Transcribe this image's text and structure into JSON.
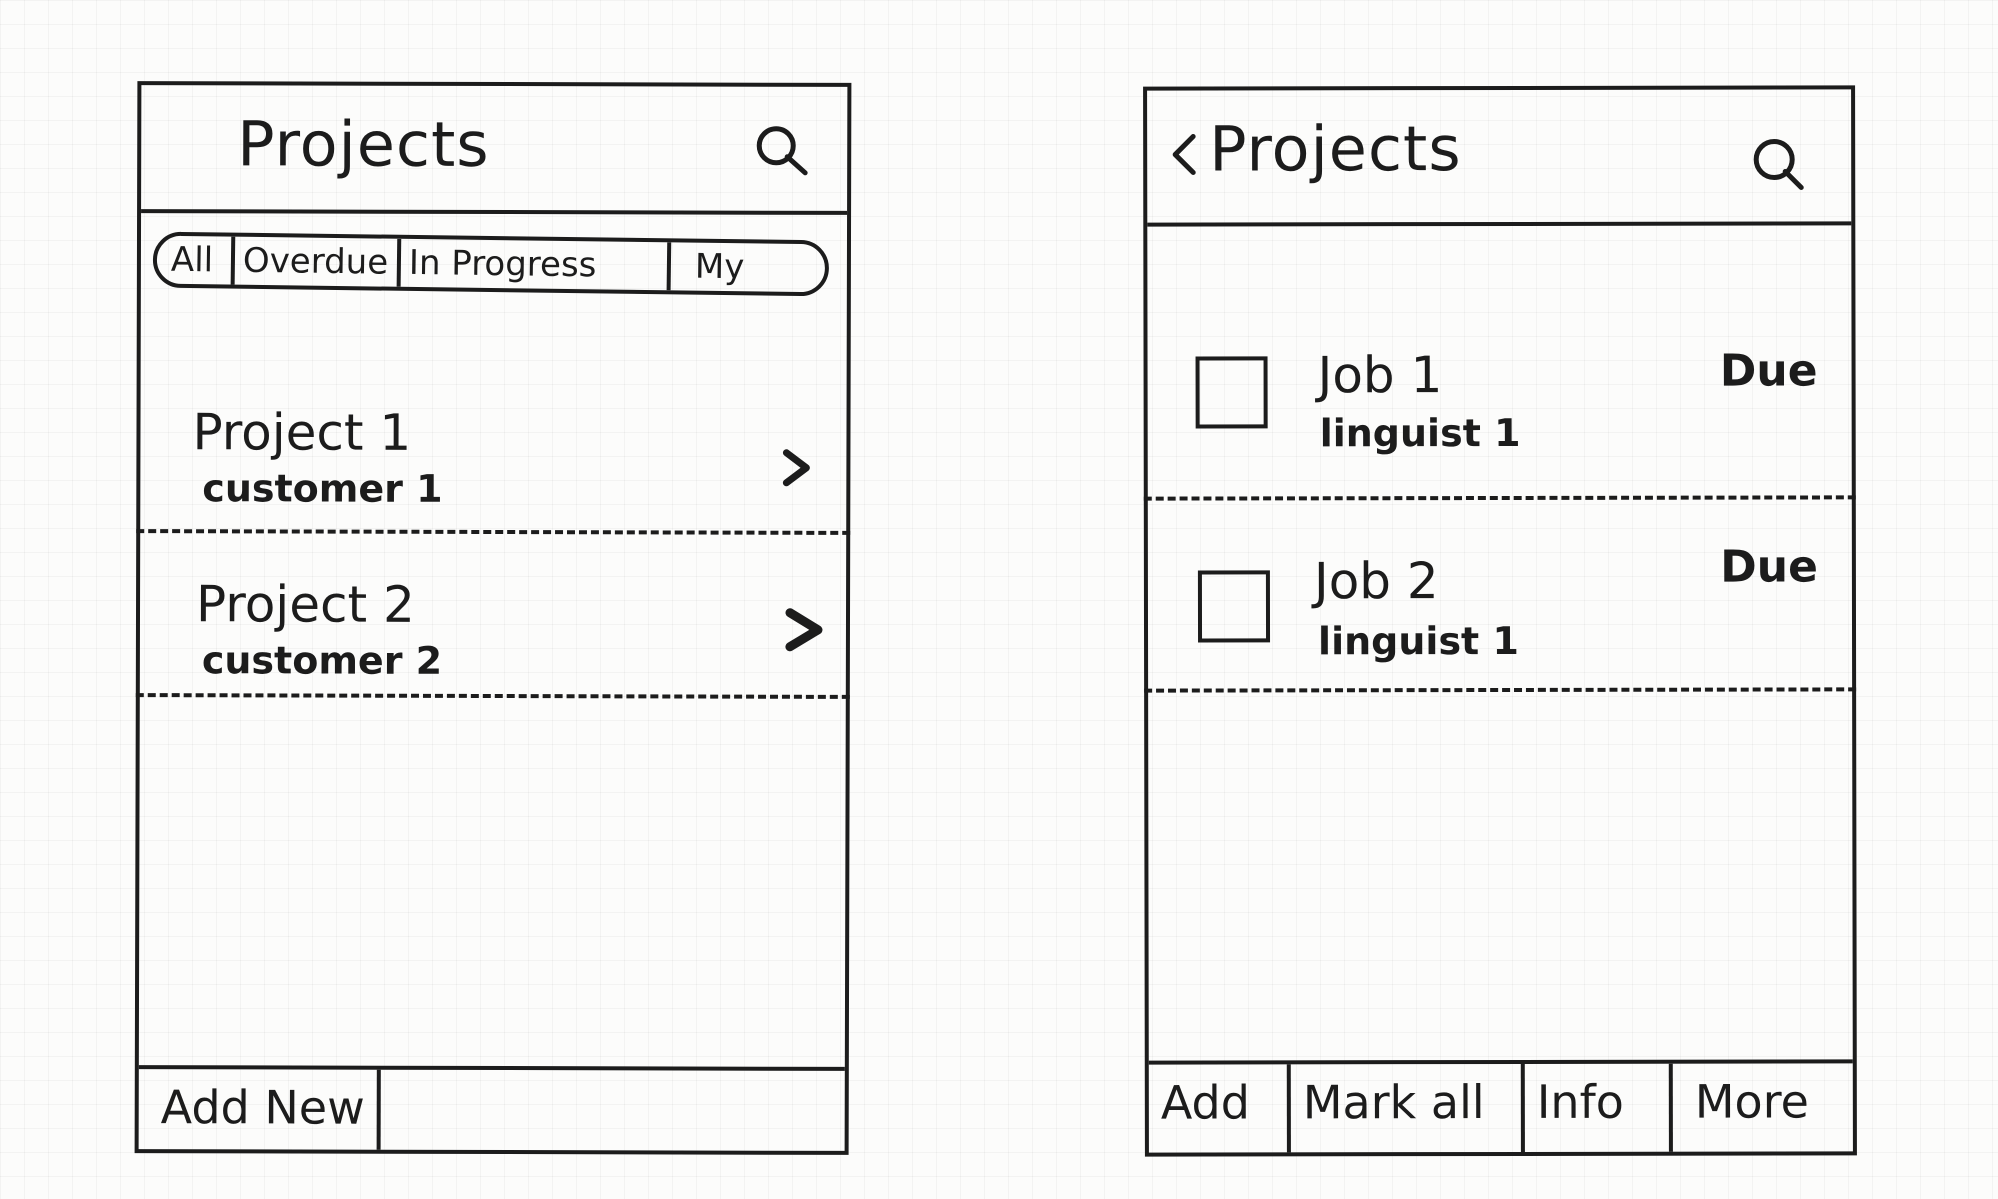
{
  "projects_screen": {
    "title": "Projects",
    "search_icon": "search-icon",
    "filters": [
      "All",
      "Overdue",
      "In Progress",
      "My"
    ],
    "items": [
      {
        "title": "Project 1",
        "subtitle": "customer 1",
        "chevron_icon": "chevron-right-icon"
      },
      {
        "title": "Project 2",
        "subtitle": "customer 2",
        "chevron_icon": "chevron-right-icon"
      }
    ],
    "bottom_bar": {
      "add_new_label": "Add New"
    }
  },
  "jobs_screen": {
    "back_icon": "chevron-left-icon",
    "title": "Projects",
    "search_icon": "search-icon",
    "items": [
      {
        "title": "Job 1",
        "subtitle": "linguist 1",
        "status": "Due"
      },
      {
        "title": "Job 2",
        "subtitle": "linguist 1",
        "status": "Due"
      }
    ],
    "bottom_bar": {
      "add_label": "Add",
      "mark_all_label": "Mark all",
      "info_label": "Info",
      "more_label": "More"
    }
  },
  "colors": {
    "ink": "#1c1c1c",
    "paper": "#fcfcfb"
  }
}
